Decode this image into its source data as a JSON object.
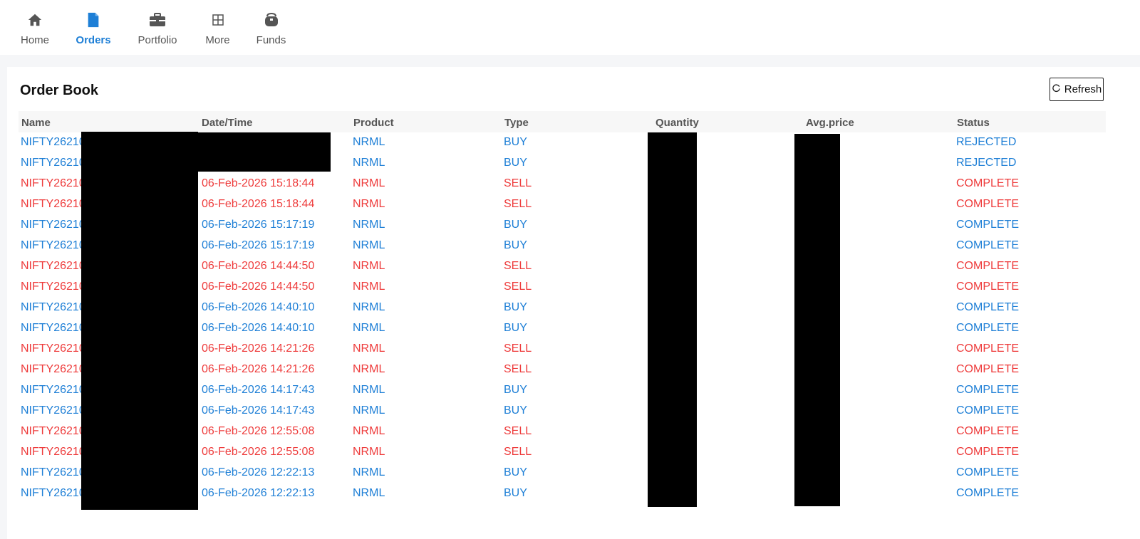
{
  "nav": {
    "items": [
      {
        "label": "Home",
        "icon": "home-icon"
      },
      {
        "label": "Orders",
        "icon": "document-icon",
        "active": true
      },
      {
        "label": "Portfolio",
        "icon": "briefcase-icon"
      },
      {
        "label": "More",
        "icon": "grid-icon"
      },
      {
        "label": "Funds",
        "icon": "wallet-icon"
      }
    ]
  },
  "page": {
    "title": "Order Book",
    "refresh_label": "Refresh"
  },
  "colors": {
    "buy": "#1e7fd6",
    "sell": "#ee3b3b",
    "accent": "#1e7fd6"
  },
  "table": {
    "columns": [
      "Name",
      "Date/Time",
      "Product",
      "Type",
      "Quantity",
      "Avg.price",
      "Status"
    ],
    "rows": [
      {
        "name": "NIFTY26210",
        "datetime": "",
        "product": "NRML",
        "type": "BUY",
        "status": "REJECTED"
      },
      {
        "name": "NIFTY26210",
        "datetime": "",
        "product": "NRML",
        "type": "BUY",
        "status": "REJECTED"
      },
      {
        "name": "NIFTY26210",
        "datetime": "06-Feb-2026 15:18:44",
        "product": "NRML",
        "type": "SELL",
        "status": "COMPLETE"
      },
      {
        "name": "NIFTY26210",
        "datetime": "06-Feb-2026 15:18:44",
        "product": "NRML",
        "type": "SELL",
        "status": "COMPLETE"
      },
      {
        "name": "NIFTY26210",
        "datetime": "06-Feb-2026 15:17:19",
        "product": "NRML",
        "type": "BUY",
        "status": "COMPLETE"
      },
      {
        "name": "NIFTY26210",
        "datetime": "06-Feb-2026 15:17:19",
        "product": "NRML",
        "type": "BUY",
        "status": "COMPLETE"
      },
      {
        "name": "NIFTY26210",
        "datetime": "06-Feb-2026 14:44:50",
        "product": "NRML",
        "type": "SELL",
        "status": "COMPLETE"
      },
      {
        "name": "NIFTY26210",
        "datetime": "06-Feb-2026 14:44:50",
        "product": "NRML",
        "type": "SELL",
        "status": "COMPLETE"
      },
      {
        "name": "NIFTY26210",
        "datetime": "06-Feb-2026 14:40:10",
        "product": "NRML",
        "type": "BUY",
        "status": "COMPLETE"
      },
      {
        "name": "NIFTY26210",
        "datetime": "06-Feb-2026 14:40:10",
        "product": "NRML",
        "type": "BUY",
        "status": "COMPLETE"
      },
      {
        "name": "NIFTY26210",
        "datetime": "06-Feb-2026 14:21:26",
        "product": "NRML",
        "type": "SELL",
        "status": "COMPLETE"
      },
      {
        "name": "NIFTY26210",
        "datetime": "06-Feb-2026 14:21:26",
        "product": "NRML",
        "type": "SELL",
        "status": "COMPLETE"
      },
      {
        "name": "NIFTY26210",
        "datetime": "06-Feb-2026 14:17:43",
        "product": "NRML",
        "type": "BUY",
        "status": "COMPLETE"
      },
      {
        "name": "NIFTY26210",
        "datetime": "06-Feb-2026 14:17:43",
        "product": "NRML",
        "type": "BUY",
        "status": "COMPLETE"
      },
      {
        "name": "NIFTY26210",
        "datetime": "06-Feb-2026 12:55:08",
        "product": "NRML",
        "type": "SELL",
        "status": "COMPLETE"
      },
      {
        "name": "NIFTY26210",
        "datetime": "06-Feb-2026 12:55:08",
        "product": "NRML",
        "type": "SELL",
        "status": "COMPLETE"
      },
      {
        "name": "NIFTY26210",
        "datetime": "06-Feb-2026 12:22:13",
        "product": "NRML",
        "type": "BUY",
        "status": "COMPLETE"
      },
      {
        "name": "NIFTY26210",
        "datetime": "06-Feb-2026 12:22:13",
        "product": "NRML",
        "type": "BUY",
        "status": "COMPLETE"
      }
    ]
  }
}
